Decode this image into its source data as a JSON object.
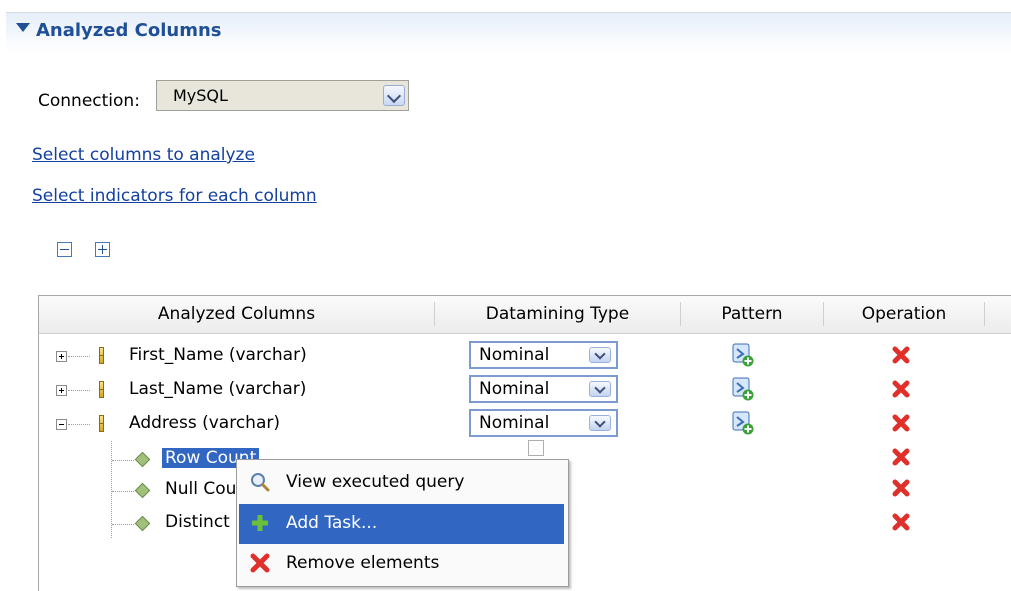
{
  "section": {
    "title": "Analyzed Columns"
  },
  "connection": {
    "label": "Connection:",
    "value": "MySQL"
  },
  "links": {
    "select_columns": "Select columns to analyze",
    "select_indicators": "Select indicators for each column"
  },
  "toolbar": {
    "collapse_icon": "collapse-all-icon",
    "expand_icon": "expand-all-icon"
  },
  "table": {
    "headers": [
      "Analyzed Columns",
      "Datamining Type",
      "Pattern",
      "Operation"
    ],
    "rows": [
      {
        "name": "First_Name (varchar)",
        "datamining_type": "Nominal",
        "pattern_icon": "add-pattern-icon",
        "operation_icon": "delete-icon",
        "expanded": false
      },
      {
        "name": "Last_Name (varchar)",
        "datamining_type": "Nominal",
        "pattern_icon": "add-pattern-icon",
        "operation_icon": "delete-icon",
        "expanded": false
      },
      {
        "name": "Address (varchar)",
        "datamining_type": "Nominal",
        "pattern_icon": "add-pattern-icon",
        "operation_icon": "delete-icon",
        "expanded": true
      }
    ],
    "indicators": [
      {
        "label": "Row Count",
        "selected": true
      },
      {
        "label": "Null Cou",
        "selected": false
      },
      {
        "label": "Distinct",
        "selected": false
      }
    ]
  },
  "context_menu": {
    "items": [
      {
        "label": "View executed query",
        "icon": "magnifier-icon",
        "active": false
      },
      {
        "label": "Add Task...",
        "icon": "green-plus-icon",
        "active": true
      },
      {
        "label": "Remove elements",
        "icon": "red-x-icon",
        "active": false
      }
    ]
  },
  "colors": {
    "header_blue": "#1e4f97",
    "link_blue": "#1440a0",
    "selection_blue": "#3166c3",
    "delete_red": "#e0302c"
  }
}
